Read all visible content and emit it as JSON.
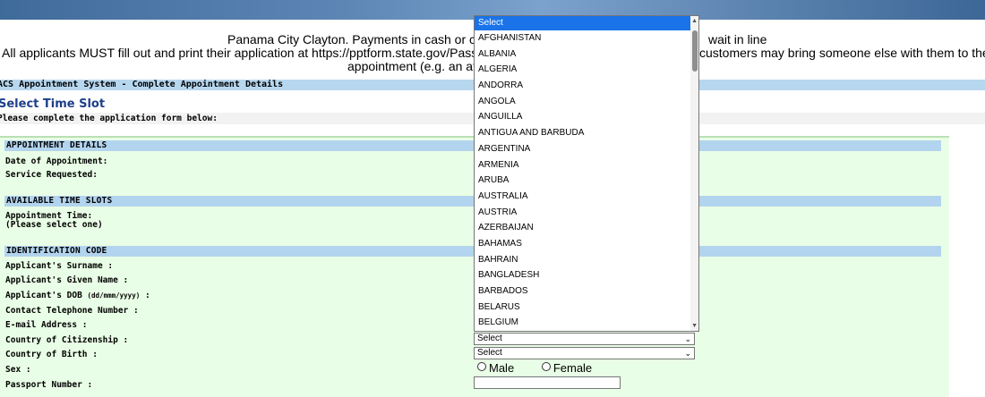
{
  "notice": {
    "line1": "Panama City Clayton. Payments in cash or cred",
    "line1_right": "wait in line",
    "line2": "All applicants MUST fill out and print their application at https://pptform.state.gov/Passp",
    "line2_right": "customers may bring someone else with them to their",
    "line3": "appointment (e.g. an attorne"
  },
  "system_bar": "ACS Appointment System - Complete Appointment Details",
  "page_title": "Select Time Slot",
  "instructions": "Please complete the application form below:",
  "sections": {
    "appointment_details": "APPOINTMENT DETAILS",
    "available_time_slots": "AVAILABLE TIME SLOTS",
    "identification_code": "IDENTIFICATION CODE"
  },
  "labels": {
    "date_of_appointment": "Date of Appointment:",
    "service_requested": "Service Requested:",
    "appointment_time": "Appointment Time:",
    "please_select_one": "(Please select one)",
    "surname": "Applicant's Surname :",
    "given_name": "Applicant's Given Name :",
    "dob": "Applicant's DOB",
    "dob_format": "(dd/mmm/yyyy)",
    "dob_colon": ":",
    "phone": "Contact Telephone Number :",
    "email": "E-mail Address :",
    "citizenship": "Country of Citizenship :",
    "birth_country": "Country of Birth :",
    "sex": "Sex :",
    "passport": "Passport Number :"
  },
  "selects": {
    "citizenship_value": "Select",
    "birth_value": "Select"
  },
  "sex_options": {
    "male": "Male",
    "female": "Female"
  },
  "dropdown": {
    "selected": "Select",
    "options": [
      "AFGHANISTAN",
      "ALBANIA",
      "ALGERIA",
      "ANDORRA",
      "ANGOLA",
      "ANGUILLA",
      "ANTIGUA AND BARBUDA",
      "ARGENTINA",
      "ARMENIA",
      "ARUBA",
      "AUSTRALIA",
      "AUSTRIA",
      "AZERBAIJAN",
      "BAHAMAS",
      "BAHRAIN",
      "BANGLADESH",
      "BARBADOS",
      "BELARUS",
      "BELGIUM"
    ]
  },
  "icons": {
    "select_arrow": "chevron-down-icon",
    "scroll_up": "scroll-up-arrow-icon",
    "scroll_down": "scroll-down-arrow-icon"
  },
  "colors": {
    "section_header": "#b2d4ee",
    "form_background": "#e9fee6",
    "selected_option": "#1a73e8"
  }
}
